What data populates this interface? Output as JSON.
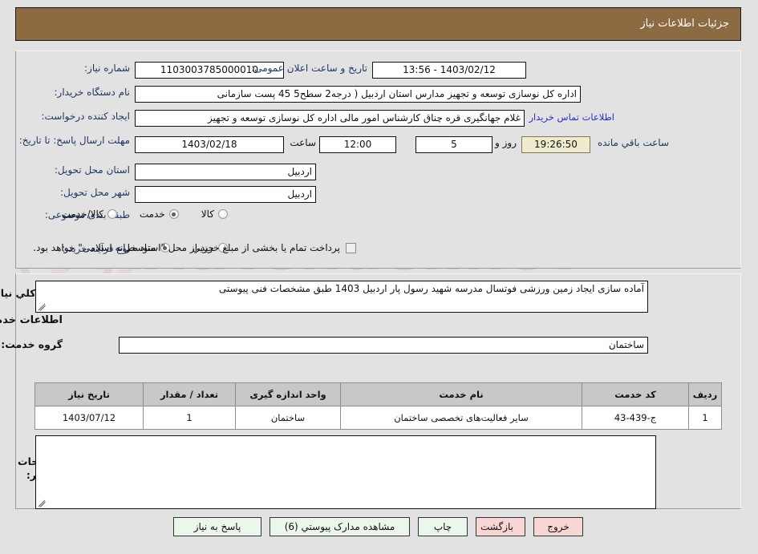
{
  "header": {
    "title": "جزئیات اطلاعات نیاز"
  },
  "watermark": {
    "text": "AriaTender.net"
  },
  "form": {
    "need_number_label": "شماره نیاز:",
    "need_number_value": "1103003785000010",
    "public_announce_label": "تاریخ و ساعت اعلان عمومی:",
    "public_announce_value": "1403/02/12 - 13:56",
    "buyer_org_label": "نام دستگاه خریدار:",
    "buyer_org_value": "اداره کل نوسازی   توسعه و تجهیز مدارس استان اردبیل ( درجه2  سطح5  45 پست سازمانی",
    "requester_label": "ایجاد کننده درخواست:",
    "requester_value": "غلام جهانگیری قره چناق کارشناس امور مالی اداره کل نوسازی   توسعه و تجهیز",
    "contact_link": "اطلاعات تماس خریدار",
    "deadline_label": "مهلت ارسال پاسخ: تا تاریخ:",
    "deadline_date": "1403/02/18",
    "time_label": "ساعت",
    "deadline_time": "12:00",
    "days_value": "5",
    "days_label": "روز و",
    "countdown_value": "19:26:50",
    "remaining_label": "ساعت باقي مانده",
    "province_label": "استان محل تحویل:",
    "province_value": "اردبیل",
    "city_label": "شهر محل تحویل:",
    "city_value": "اردبیل",
    "category_label": "طبقه بندی موضوعی:",
    "category_options": [
      {
        "label": "کالا",
        "selected": false
      },
      {
        "label": "خدمت",
        "selected": true
      },
      {
        "label": "کالا/خدمت",
        "selected": false
      }
    ],
    "process_label": "نوع فرآیند خرید :",
    "process_options": [
      {
        "label": "جزيي",
        "selected": false
      },
      {
        "label": "متوسط",
        "selected": true
      }
    ],
    "payment_note": "پرداخت تمام یا بخشی از مبلغ خرید،از محل \"اسناد خزانه اسلامی\" خواهد بود."
  },
  "description": {
    "label": "شرح کلي نیاز:",
    "value": "آماده سازی ایجاد زمین ورزشی فوتسال مدرسه شهید رسول پار اردبیل 1403 طبق مشخصات فنی پیوستی"
  },
  "services_section": {
    "heading": "اطلاعات خدمات مورد نیاز",
    "group_label": "گروه خدمت:",
    "group_value": "ساختمان"
  },
  "table": {
    "headers": [
      "ردیف",
      "کد خدمت",
      "نام خدمت",
      "واحد اندازه گیری",
      "تعداد / مقدار",
      "تاریخ نیاز"
    ],
    "rows": [
      [
        "1",
        "ج-439-43",
        "سایر فعالیت‌های تخصصی ساختمان",
        "ساختمان",
        "1",
        "1403/07/12"
      ]
    ]
  },
  "buyer_notes": {
    "label_line1": "توضیحات",
    "label_line2": "خریدار:",
    "value": ""
  },
  "buttons": [
    {
      "label": "پاسخ به نیاز",
      "style": "green"
    },
    {
      "label": "مشاهده مدارک پیوستي (6)",
      "style": "green"
    },
    {
      "label": "چاپ",
      "style": "green"
    },
    {
      "label": "بازگشت",
      "style": "red"
    },
    {
      "label": "خروج",
      "style": "red"
    }
  ],
  "colors": {
    "header_brown": "#8d6b42",
    "page_bg": "#e2e2e2",
    "label_blue": "#1f3864",
    "link_blue": "#2a2ad0",
    "table_header": "#c8c8c8",
    "countdown_bg": "#eeeccd",
    "btn_green": "#eaf7ea",
    "btn_red": "#f9d6d6"
  }
}
